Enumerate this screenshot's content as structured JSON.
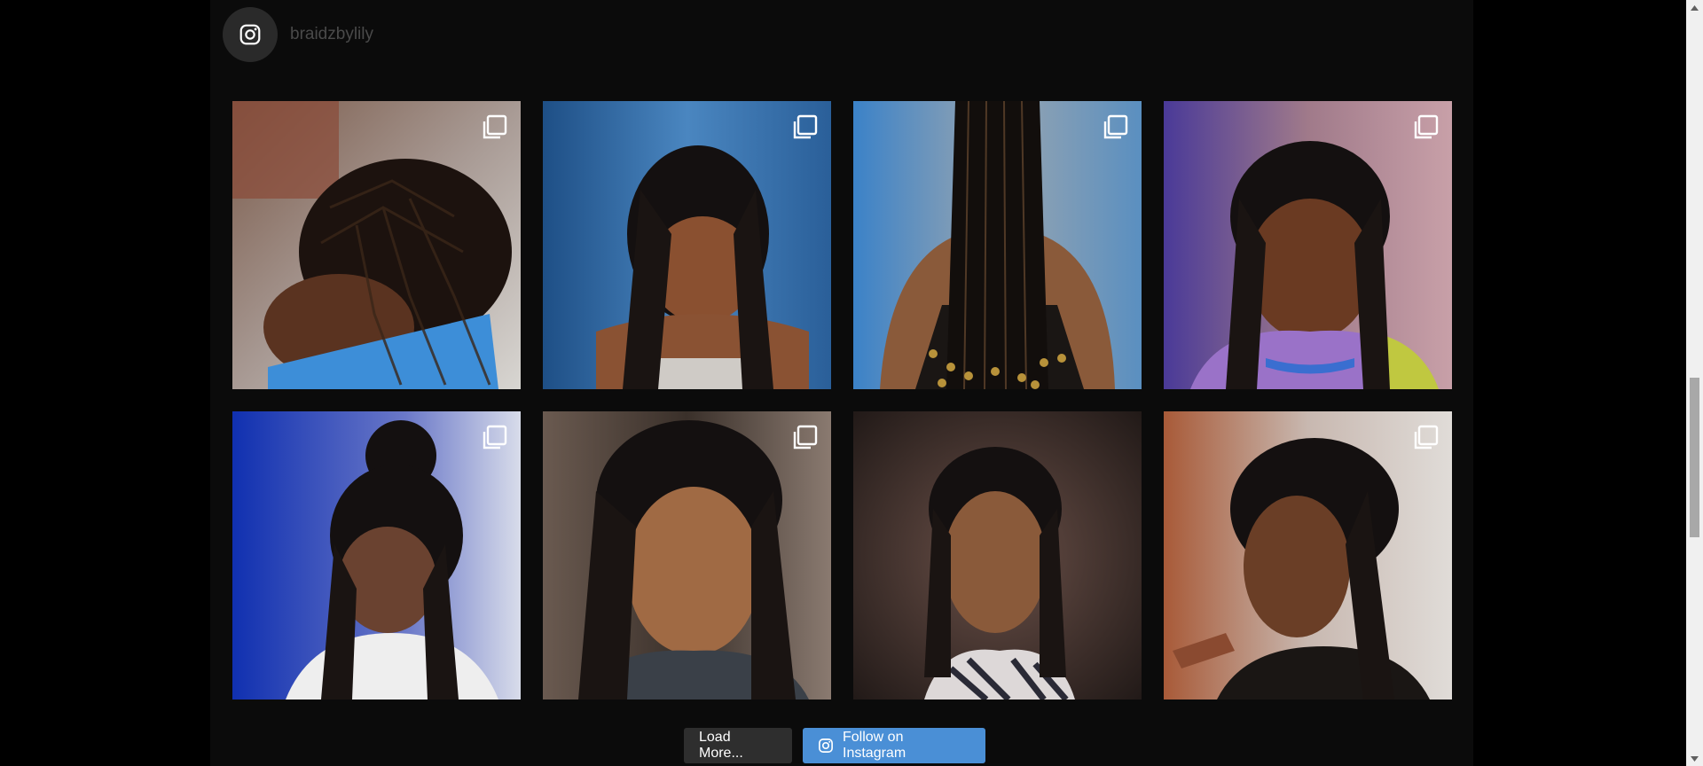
{
  "profile": {
    "username": "braidzbylily"
  },
  "posts": [
    {
      "alt": "braided hairstyle photo 1"
    },
    {
      "alt": "braided hairstyle photo 2"
    },
    {
      "alt": "braided hairstyle photo 3"
    },
    {
      "alt": "braided hairstyle photo 4"
    },
    {
      "alt": "braided hairstyle photo 5"
    },
    {
      "alt": "braided hairstyle photo 6"
    },
    {
      "alt": "braided hairstyle photo 7"
    },
    {
      "alt": "braided hairstyle photo 8"
    }
  ],
  "actions": {
    "load_more_label": "Load More...",
    "follow_label": "Follow on Instagram"
  },
  "colors": {
    "follow_button": "#4a8fd6",
    "load_more_button": "#2e2e2e",
    "feed_background": "#0b0b0b"
  },
  "icons": {
    "profile": "instagram-icon",
    "post_badge": "carousel-icon",
    "follow": "instagram-icon"
  }
}
